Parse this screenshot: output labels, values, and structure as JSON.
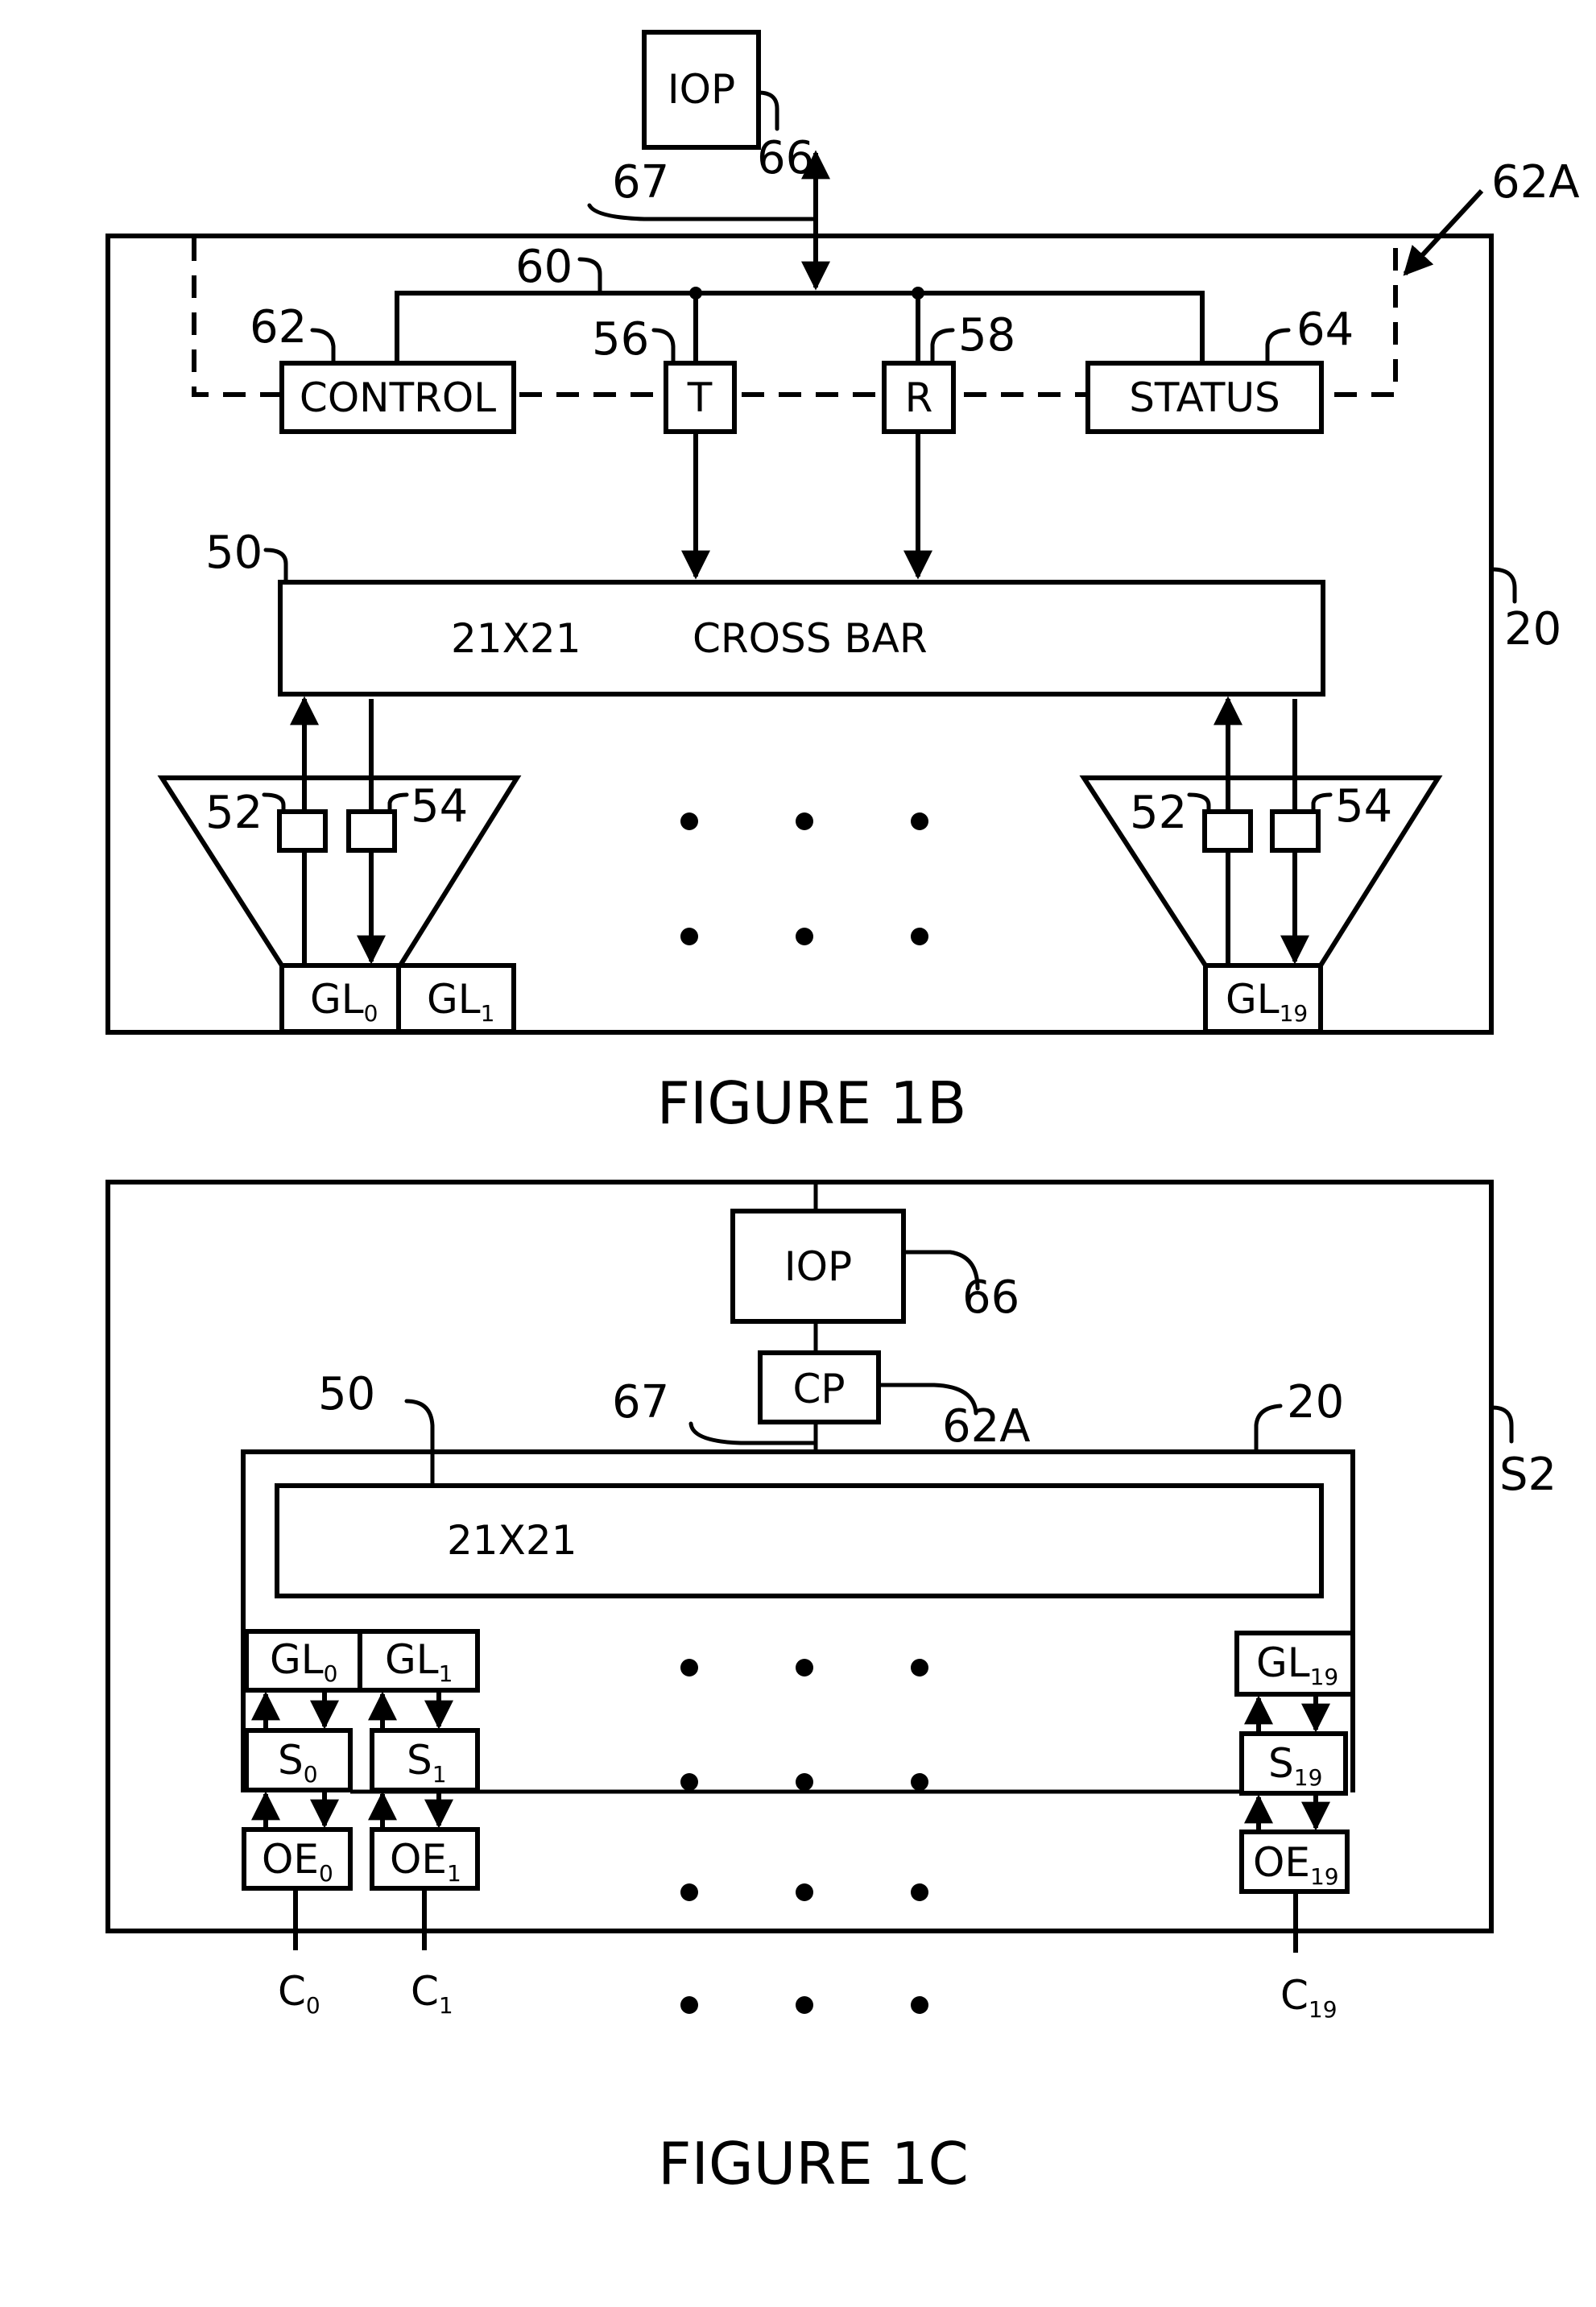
{
  "figure_1b": {
    "caption": "FIGURE 1B",
    "blocks": {
      "iop": "IOP",
      "control": "CONTROL",
      "transmit": "T",
      "receive": "R",
      "status": "STATUS",
      "crossbar_size": "21X21",
      "crossbar_name": "CROSS BAR",
      "gl0_main": "GL",
      "gl0_sub": "0",
      "gl1_main": "GL",
      "gl1_sub": "1",
      "gl19_main": "GL",
      "gl19_sub": "19"
    },
    "refs": {
      "iop": "66",
      "link": "67",
      "control_processor": "62A",
      "bus": "60",
      "control": "62",
      "transmit": "56",
      "receive": "58",
      "status": "64",
      "crossbar": "50",
      "switch": "20",
      "left_in_buffer": "52",
      "left_out_buffer": "54",
      "right_in_buffer": "52",
      "right_out_buffer": "54"
    }
  },
  "figure_1c": {
    "caption": "FIGURE 1C",
    "blocks": {
      "iop": "IOP",
      "cp": "CP",
      "crossbar_size": "21X21",
      "gl": [
        {
          "main": "GL",
          "sub": "0"
        },
        {
          "main": "GL",
          "sub": "1"
        },
        {
          "main": "GL",
          "sub": "19"
        }
      ],
      "s": [
        {
          "main": "S",
          "sub": "0"
        },
        {
          "main": "S",
          "sub": "1"
        },
        {
          "main": "S",
          "sub": "19"
        }
      ],
      "oe": [
        {
          "main": "OE",
          "sub": "0"
        },
        {
          "main": "OE",
          "sub": "1"
        },
        {
          "main": "OE",
          "sub": "19"
        }
      ],
      "c": [
        {
          "main": "C",
          "sub": "0"
        },
        {
          "main": "C",
          "sub": "1"
        },
        {
          "main": "C",
          "sub": "19"
        }
      ]
    },
    "refs": {
      "iop": "66",
      "cp": "62A",
      "link": "67",
      "crossbar": "50",
      "switch": "20",
      "system": "S2"
    }
  }
}
